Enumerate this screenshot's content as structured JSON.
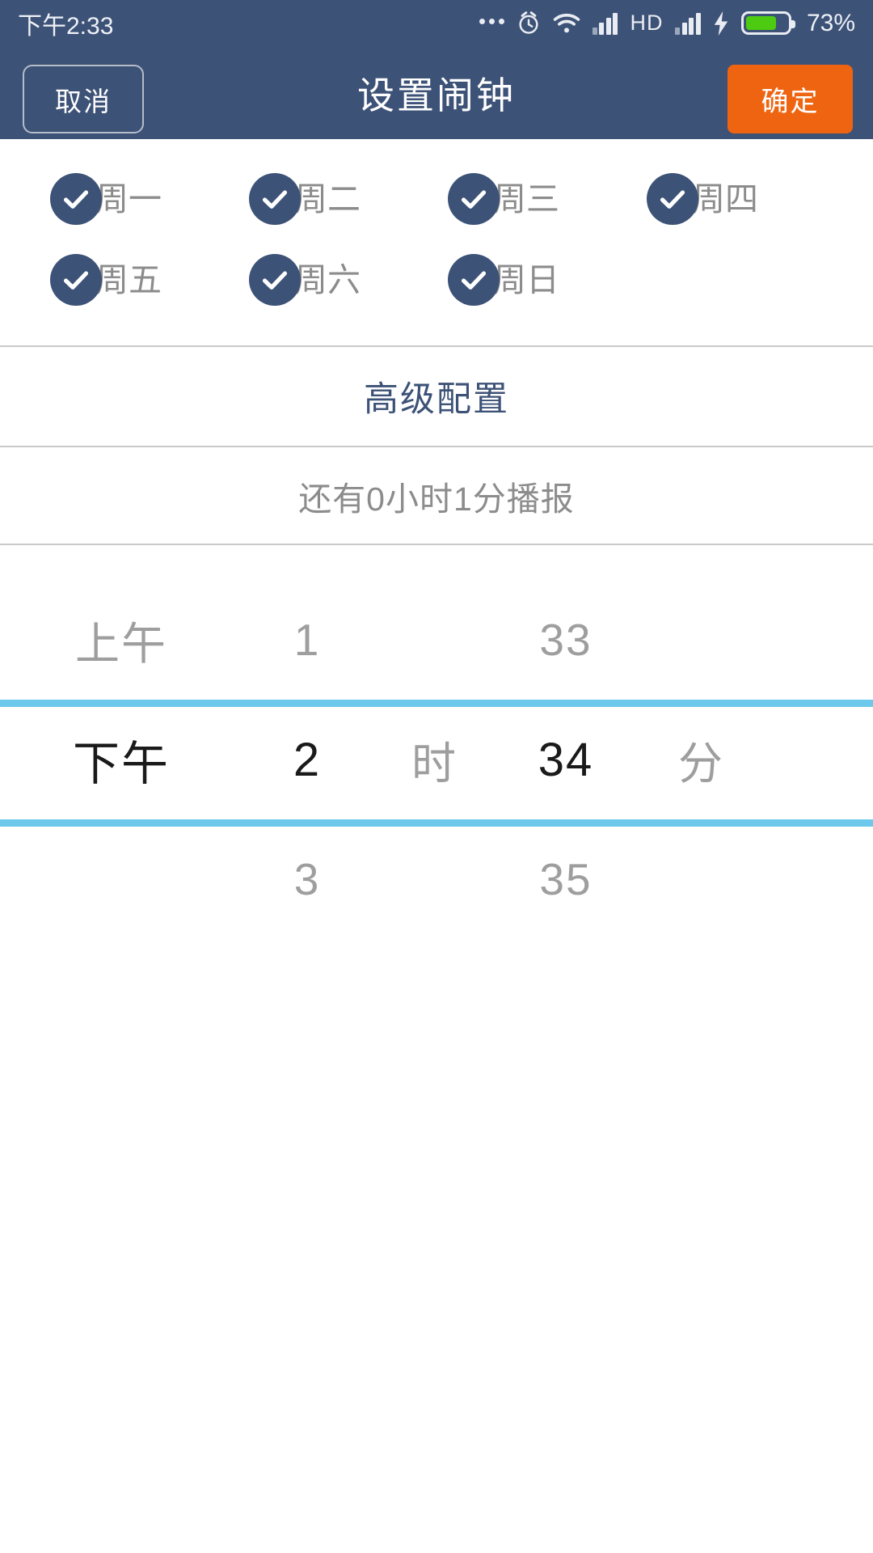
{
  "statusbar": {
    "time": "下午2:33",
    "battery_percent": "73%",
    "hd_label": "HD",
    "icons": [
      "more-dots-icon",
      "alarm-clock-icon",
      "wifi-icon",
      "signal-bars-icon",
      "hd-icon",
      "signal-bars-2-icon",
      "charging-bolt-icon",
      "battery-icon"
    ]
  },
  "header": {
    "title": "设置闹钟",
    "cancel_label": "取消",
    "confirm_label": "确定",
    "background_color": "#3d5277",
    "confirm_color": "#ee6411"
  },
  "weekdays": {
    "rows": [
      [
        {
          "label": "周一",
          "checked": true
        },
        {
          "label": "周二",
          "checked": true
        },
        {
          "label": "周三",
          "checked": true
        },
        {
          "label": "周四",
          "checked": true
        }
      ],
      [
        {
          "label": "周五",
          "checked": true
        },
        {
          "label": "周六",
          "checked": true
        },
        {
          "label": "周日",
          "checked": true
        }
      ]
    ],
    "check_color": "#3d5277"
  },
  "advanced": {
    "label": "高级配置",
    "color": "#3d5277"
  },
  "countdown": {
    "label": "还有0小时1分播报"
  },
  "picker": {
    "highlight_color": "#6dc9ec",
    "hour_unit": "时",
    "minute_unit": "分",
    "rows": {
      "previous": {
        "ampm": "上午",
        "hour": "1",
        "minute": "33"
      },
      "selected": {
        "ampm": "下午",
        "hour": "2",
        "minute": "34"
      },
      "next": {
        "ampm": "",
        "hour": "3",
        "minute": "35"
      }
    }
  }
}
